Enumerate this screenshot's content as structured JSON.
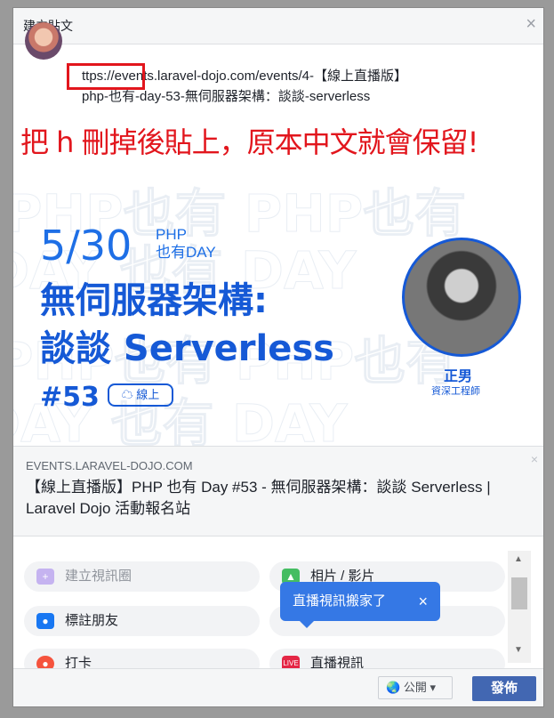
{
  "dialog": {
    "title": "建立貼文",
    "close_glyph": "×"
  },
  "post": {
    "line1": "ttps://events.laravel-dojo.com/events/4-【線上直播版】",
    "line2": "php-也有-day-53-無伺服器架構：談談-serverless"
  },
  "annotation": {
    "text": "把 h 刪掉後貼上，原本中文就會保留!",
    "color": "#e2161d"
  },
  "banner": {
    "date": "5/30",
    "tag_line1": "PHP",
    "tag_line2": "也有DAY",
    "headline_line1": "無伺服器架構:",
    "headline_line2": "談談 Serverless",
    "number": "#53",
    "online_badge": "線上",
    "speaker_name": "正男",
    "speaker_role": "資深工程師",
    "watermark": "PHP也有 DAY"
  },
  "link_preview": {
    "domain": "EVENTS.LARAVEL-DOJO.COM",
    "title": "【線上直播版】PHP 也有 Day #53 - 無伺服器架構：談談 Serverless | Laravel Dojo 活動報名站",
    "close_glyph": "×"
  },
  "actions": [
    {
      "label": "建立視訊圈",
      "icon": "video-room-icon",
      "color": "#c5b3f0"
    },
    {
      "label": "相片 / 影片",
      "icon": "photo-icon",
      "color": "#45bd62"
    },
    {
      "label": "標註朋友",
      "icon": "tag-friends-icon",
      "color": "#1877f2"
    },
    {
      "label": "打卡",
      "icon": "check-in-icon",
      "color": "#f5533d"
    },
    {
      "label": "直播視訊",
      "icon": "live-video-icon",
      "color": "#e42645"
    }
  ],
  "tooltip": {
    "text": "直播視訊搬家了",
    "close_glyph": "×"
  },
  "footer": {
    "audience": "公開",
    "post_button": "發佈"
  },
  "colors": {
    "brand_blue": "#4267b2",
    "banner_blue": "#1559d6"
  }
}
